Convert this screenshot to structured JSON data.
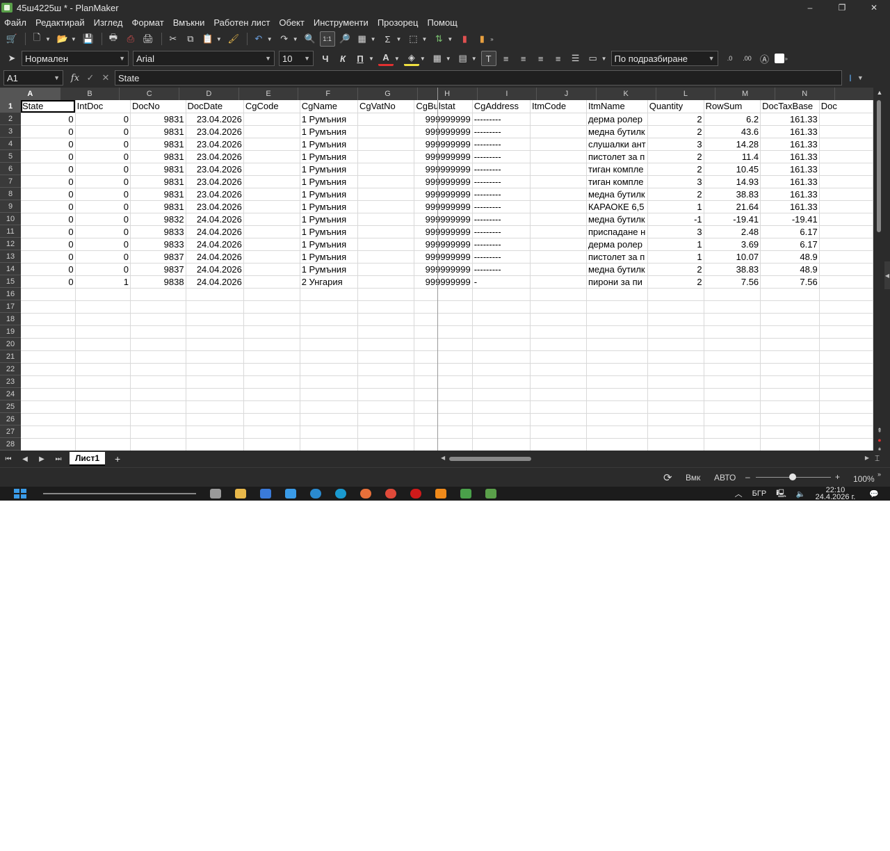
{
  "window": {
    "title": "45ш4225ш * - PlanMaker",
    "minimize": "–",
    "restore": "❐",
    "close": "✕"
  },
  "menu": [
    "Файл",
    "Редактирай",
    "Изглед",
    "Формат",
    "Вмъкни",
    "Работен лист",
    "Обект",
    "Инструменти",
    "Прозорец",
    "Помощ"
  ],
  "format_bar": {
    "style": "Нормален",
    "font": "Arial",
    "size": "10",
    "bold": "Ч",
    "italic": "К",
    "underline": "П",
    "font_color_glyph": "A",
    "number_format": "По подразбиране"
  },
  "formula_bar": {
    "cell_ref": "A1",
    "fx": "fx",
    "content": "State"
  },
  "columns": [
    "A",
    "B",
    "C",
    "D",
    "E",
    "F",
    "G",
    "H",
    "I",
    "J",
    "K",
    "L",
    "M",
    "N",
    ""
  ],
  "header_row": [
    "State",
    "IntDoc",
    "DocNo",
    "DocDate",
    "CgCode",
    "CgName",
    "CgVatNo",
    "CgBulstat",
    "CgAddress",
    "ItmCode",
    "ItmName",
    "Quantity",
    "RowSum",
    "DocTaxBase",
    "Doc"
  ],
  "rows": [
    [
      "0",
      "0",
      "9831",
      "23.04.2026",
      "",
      "1 Румъния",
      "",
      "999999999",
      "---------",
      "",
      "дерма ролер",
      "2",
      "6.2",
      "161.33",
      ""
    ],
    [
      "0",
      "0",
      "9831",
      "23.04.2026",
      "",
      "1 Румъния",
      "",
      "999999999",
      "---------",
      "",
      "медна бутилк",
      "2",
      "43.6",
      "161.33",
      ""
    ],
    [
      "0",
      "0",
      "9831",
      "23.04.2026",
      "",
      "1 Румъния",
      "",
      "999999999",
      "---------",
      "",
      "слушалки ант",
      "3",
      "14.28",
      "161.33",
      ""
    ],
    [
      "0",
      "0",
      "9831",
      "23.04.2026",
      "",
      "1 Румъния",
      "",
      "999999999",
      "---------",
      "",
      "пистолет за п",
      "2",
      "11.4",
      "161.33",
      ""
    ],
    [
      "0",
      "0",
      "9831",
      "23.04.2026",
      "",
      "1 Румъния",
      "",
      "999999999",
      "---------",
      "",
      "тиган компле",
      "2",
      "10.45",
      "161.33",
      ""
    ],
    [
      "0",
      "0",
      "9831",
      "23.04.2026",
      "",
      "1 Румъния",
      "",
      "999999999",
      "---------",
      "",
      "тиган компле",
      "3",
      "14.93",
      "161.33",
      ""
    ],
    [
      "0",
      "0",
      "9831",
      "23.04.2026",
      "",
      "1 Румъния",
      "",
      "999999999",
      "---------",
      "",
      "медна бутилк",
      "2",
      "38.83",
      "161.33",
      ""
    ],
    [
      "0",
      "0",
      "9831",
      "23.04.2026",
      "",
      "1 Румъния",
      "",
      "999999999",
      "---------",
      "",
      "КАРАОКЕ 6,5",
      "1",
      "21.64",
      "161.33",
      ""
    ],
    [
      "0",
      "0",
      "9832",
      "24.04.2026",
      "",
      "1 Румъния",
      "",
      "999999999",
      "---------",
      "",
      "медна бутилк",
      "-1",
      "-19.41",
      "-19.41",
      ""
    ],
    [
      "0",
      "0",
      "9833",
      "24.04.2026",
      "",
      "1 Румъния",
      "",
      "999999999",
      "---------",
      "",
      "приспадане н",
      "3",
      "2.48",
      "6.17",
      ""
    ],
    [
      "0",
      "0",
      "9833",
      "24.04.2026",
      "",
      "1 Румъния",
      "",
      "999999999",
      "---------",
      "",
      "дерма ролер",
      "1",
      "3.69",
      "6.17",
      ""
    ],
    [
      "0",
      "0",
      "9837",
      "24.04.2026",
      "",
      "1 Румъния",
      "",
      "999999999",
      "---------",
      "",
      "пистолет за  п",
      "1",
      "10.07",
      "48.9",
      ""
    ],
    [
      "0",
      "0",
      "9837",
      "24.04.2026",
      "",
      "1 Румъния",
      "",
      "999999999",
      "---------",
      "",
      "медна бутилк",
      "2",
      "38.83",
      "48.9",
      ""
    ],
    [
      "0",
      "1",
      "9838",
      "24.04.2026",
      "",
      "2 Унгария",
      "",
      "999999999",
      "-",
      "",
      "пирони за пи",
      "2",
      "7.56",
      "7.56",
      ""
    ]
  ],
  "row_numbers": [
    "1",
    "2",
    "3",
    "4",
    "5",
    "6",
    "7",
    "8",
    "9",
    "10",
    "11",
    "12",
    "13",
    "14",
    "15",
    "16",
    "17",
    "18",
    "19",
    "20",
    "21",
    "22",
    "23",
    "24",
    "25",
    "26",
    "27",
    "28"
  ],
  "sheet_tabs": [
    "Лист1"
  ],
  "add_sheet": "+",
  "status": {
    "insert_mode": "Вмк",
    "calc_mode": "АВТО",
    "zoom_minus": "–",
    "zoom_plus": "+",
    "zoom": "100%"
  },
  "taskbar": {
    "language": "БГР",
    "time": "22:10",
    "date": "24.4.2026 г."
  },
  "colors": {
    "app_bg": "#2b2b2b",
    "grid_bg": "#ffffff",
    "accent": "#3a9be8"
  }
}
